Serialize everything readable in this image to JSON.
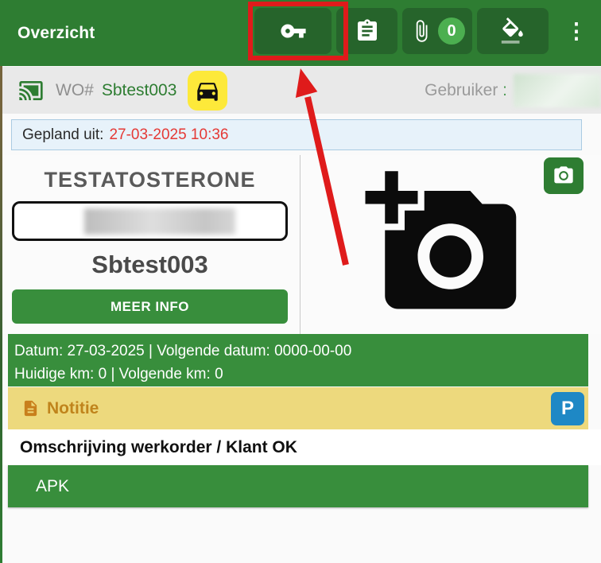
{
  "header": {
    "title": "Overzicht",
    "attachment_count": "0",
    "menu_glyph": "⋮"
  },
  "workorder_bar": {
    "wo_label": "WO#",
    "wo_number": "Sbtest003",
    "user_label": "Gebruiker",
    "user_colon": ":"
  },
  "planned": {
    "label": "Gepland uit:",
    "datetime": "27-03-2025 10:36"
  },
  "vehicle": {
    "name": "TESTATOSTERONE",
    "workorder_code": "Sbtest003",
    "more_info_label": "MEER INFO"
  },
  "maintenance": {
    "line1": "Datum: 27-03-2025 | Volgende datum: 0000-00-00",
    "line2": "Huidige km: 0 | Volgende km: 0"
  },
  "note": {
    "label": "Notitie",
    "p_button_label": "P"
  },
  "description": {
    "title": "Omschrijving werkorder / Klant OK"
  },
  "tasks": [
    {
      "label": "APK"
    }
  ],
  "icons": {
    "toolbar": [
      "key-icon",
      "clipboard-icon",
      "paperclip-icon",
      "paint-fill-icon",
      "overflow-menu-icon"
    ],
    "workorder_bar": [
      "cast-icon",
      "car-icon"
    ],
    "vehicle": [
      "add-photo-icon",
      "camera-icon"
    ],
    "note": [
      "note-document-icon"
    ]
  },
  "colors": {
    "header_green": "#2e7d32",
    "toolbar_button_green": "#26642b",
    "badge_green": "#4caf50",
    "section_green": "#388e3c",
    "car_button_yellow": "#fde93a",
    "note_bar_yellow": "#edd97d",
    "note_text_orange": "#c0841c",
    "p_button_blue": "#1e88c5",
    "planned_box_blue_bg": "#e7f2fa",
    "planned_date_red": "#e53935",
    "annotation_red": "#df1b1b"
  },
  "annotations": {
    "highlight_target": "key-button",
    "arrow": "points-to-key-button"
  }
}
